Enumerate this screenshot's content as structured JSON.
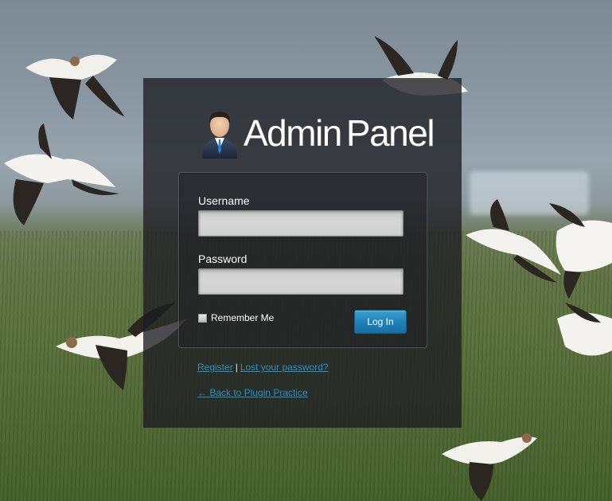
{
  "branding": {
    "title_part1": "Admin",
    "title_part2": "Panel",
    "avatar_icon": "businessman-avatar-icon"
  },
  "login_form": {
    "username_label": "Username",
    "username_value": "",
    "password_label": "Password",
    "password_value": "",
    "remember_label": "Remember Me",
    "remember_checked": false,
    "submit_label": "Log In"
  },
  "links": {
    "register": "Register",
    "separator": "|",
    "lost_password": "Lost your password?",
    "back": "← Back to Plugin Practice"
  },
  "colors": {
    "panel_bg": "#1c1e22",
    "accent_button": "#1f7fb8",
    "link": "#2d8fc4",
    "text": "#ffffff"
  }
}
